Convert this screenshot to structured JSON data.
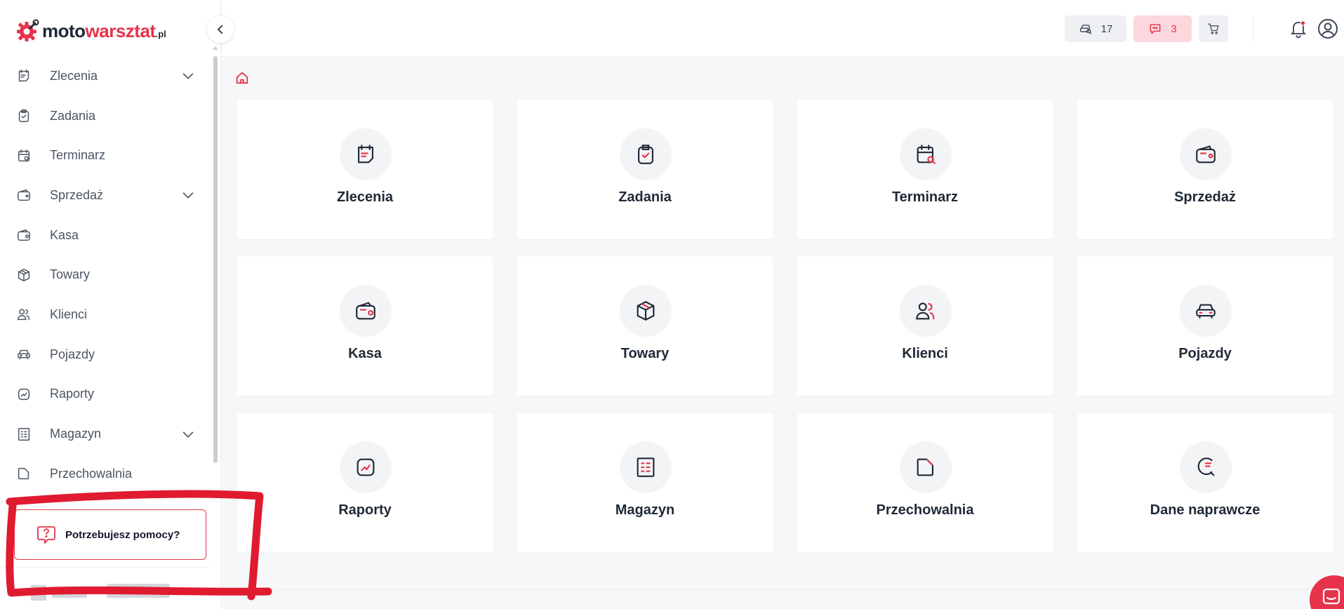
{
  "brand": {
    "logo_moto": "moto",
    "logo_warsztat": "warsztat",
    "logo_pl": ".pl",
    "accent_color": "#e6334b"
  },
  "sidebar": {
    "items": [
      {
        "label": "Zlecenia",
        "icon": "orders-icon",
        "expandable": true
      },
      {
        "label": "Zadania",
        "icon": "tasks-icon",
        "expandable": false
      },
      {
        "label": "Terminarz",
        "icon": "calendar-icon",
        "expandable": false
      },
      {
        "label": "Sprzedaż",
        "icon": "wallet-icon",
        "expandable": true
      },
      {
        "label": "Kasa",
        "icon": "cash-icon",
        "expandable": false
      },
      {
        "label": "Towary",
        "icon": "box-icon",
        "expandable": false
      },
      {
        "label": "Klienci",
        "icon": "users-icon",
        "expandable": false
      },
      {
        "label": "Pojazdy",
        "icon": "car-icon",
        "expandable": false
      },
      {
        "label": "Raporty",
        "icon": "chart-icon",
        "expandable": false
      },
      {
        "label": "Magazyn",
        "icon": "warehouse-icon",
        "expandable": true
      },
      {
        "label": "Przechowalnia",
        "icon": "storage-icon",
        "expandable": false
      }
    ],
    "help_label": "Potrzebujesz pomocy?"
  },
  "topbar": {
    "cars_count": "17",
    "messages_count": "3"
  },
  "tiles": [
    {
      "label": "Zlecenia",
      "icon": "orders-icon"
    },
    {
      "label": "Zadania",
      "icon": "tasks-icon"
    },
    {
      "label": "Terminarz",
      "icon": "calendar-icon"
    },
    {
      "label": "Sprzedaż",
      "icon": "wallet-icon"
    },
    {
      "label": "Kasa",
      "icon": "cash-icon"
    },
    {
      "label": "Towary",
      "icon": "box-icon"
    },
    {
      "label": "Klienci",
      "icon": "users-icon"
    },
    {
      "label": "Pojazdy",
      "icon": "car-icon"
    },
    {
      "label": "Raporty",
      "icon": "chart-icon"
    },
    {
      "label": "Magazyn",
      "icon": "warehouse-icon"
    },
    {
      "label": "Przechowalnia",
      "icon": "storage-icon"
    },
    {
      "label": "Dane naprawcze",
      "icon": "repair-data-icon"
    }
  ]
}
